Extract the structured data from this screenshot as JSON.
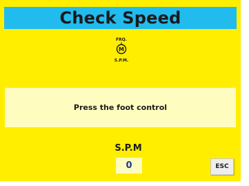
{
  "screen": {
    "title": "Check Speed",
    "background_color": "#ffee00",
    "title_bar_color": "#22bbee",
    "panel_color": "#fffcc0"
  },
  "motor_icon": {
    "icon": "motor-icon",
    "top_label": "FRQ.",
    "center_label": "M",
    "bottom_label": "S.P.M."
  },
  "message": {
    "text": "Press the foot control"
  },
  "spm": {
    "label": "S.P.M",
    "value": "0",
    "value_color": "#1f3a8a"
  },
  "buttons": {
    "esc_label": "ESC"
  }
}
